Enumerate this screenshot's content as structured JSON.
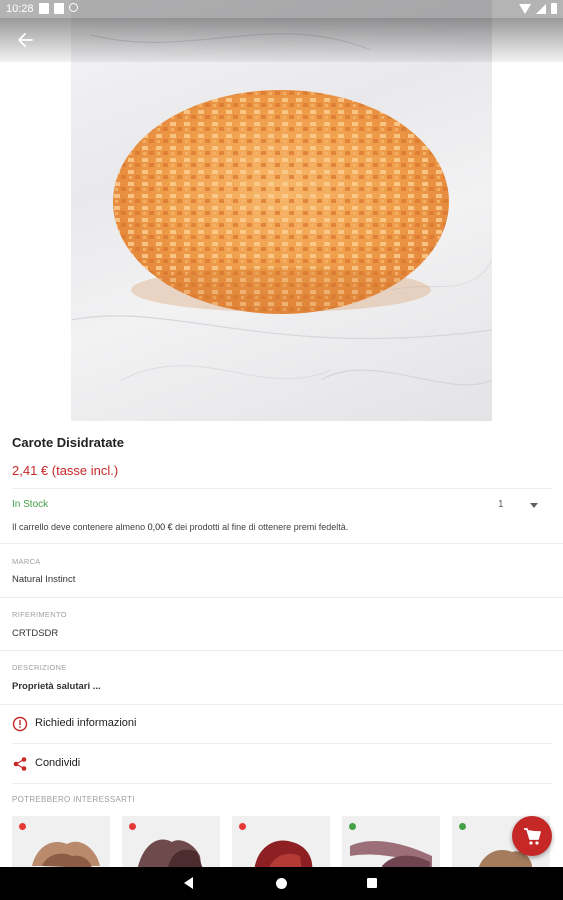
{
  "status_bar": {
    "time": "10:28"
  },
  "product": {
    "title": "Carote Disidratate",
    "price": "2,41 € (tasse incl.)",
    "stock": "In Stock",
    "quantity": "1",
    "loyalty_prefix": "Il carrello deve contenere almeno ",
    "loyalty_amount": "0,00 €",
    "loyalty_suffix": " dei prodotti al fine di ottenere premi fedeltà."
  },
  "sections": {
    "brand_label": "MARCA",
    "brand_value": "Natural Instinct",
    "reference_label": "RIFERIMENTO",
    "reference_value": "CRTDSDR",
    "description_label": "DESCRIZIONE",
    "description_value": "Proprietà salutari ..."
  },
  "actions": {
    "info_label": "Richiedi informazioni",
    "share_label": "Condividi"
  },
  "suggestions": {
    "title": "POTREBBERO INTERESSARTI",
    "items": [
      {
        "status": "red"
      },
      {
        "status": "red"
      },
      {
        "status": "red"
      },
      {
        "status": "green"
      },
      {
        "status": "green"
      }
    ]
  },
  "colors": {
    "accent": "#c62828",
    "in_stock": "#43a047",
    "out_of_stock": "#e53935"
  },
  "icons": {
    "back": "arrow-left-icon",
    "info": "info-circle-icon",
    "share": "share-icon",
    "cart": "cart-icon"
  }
}
